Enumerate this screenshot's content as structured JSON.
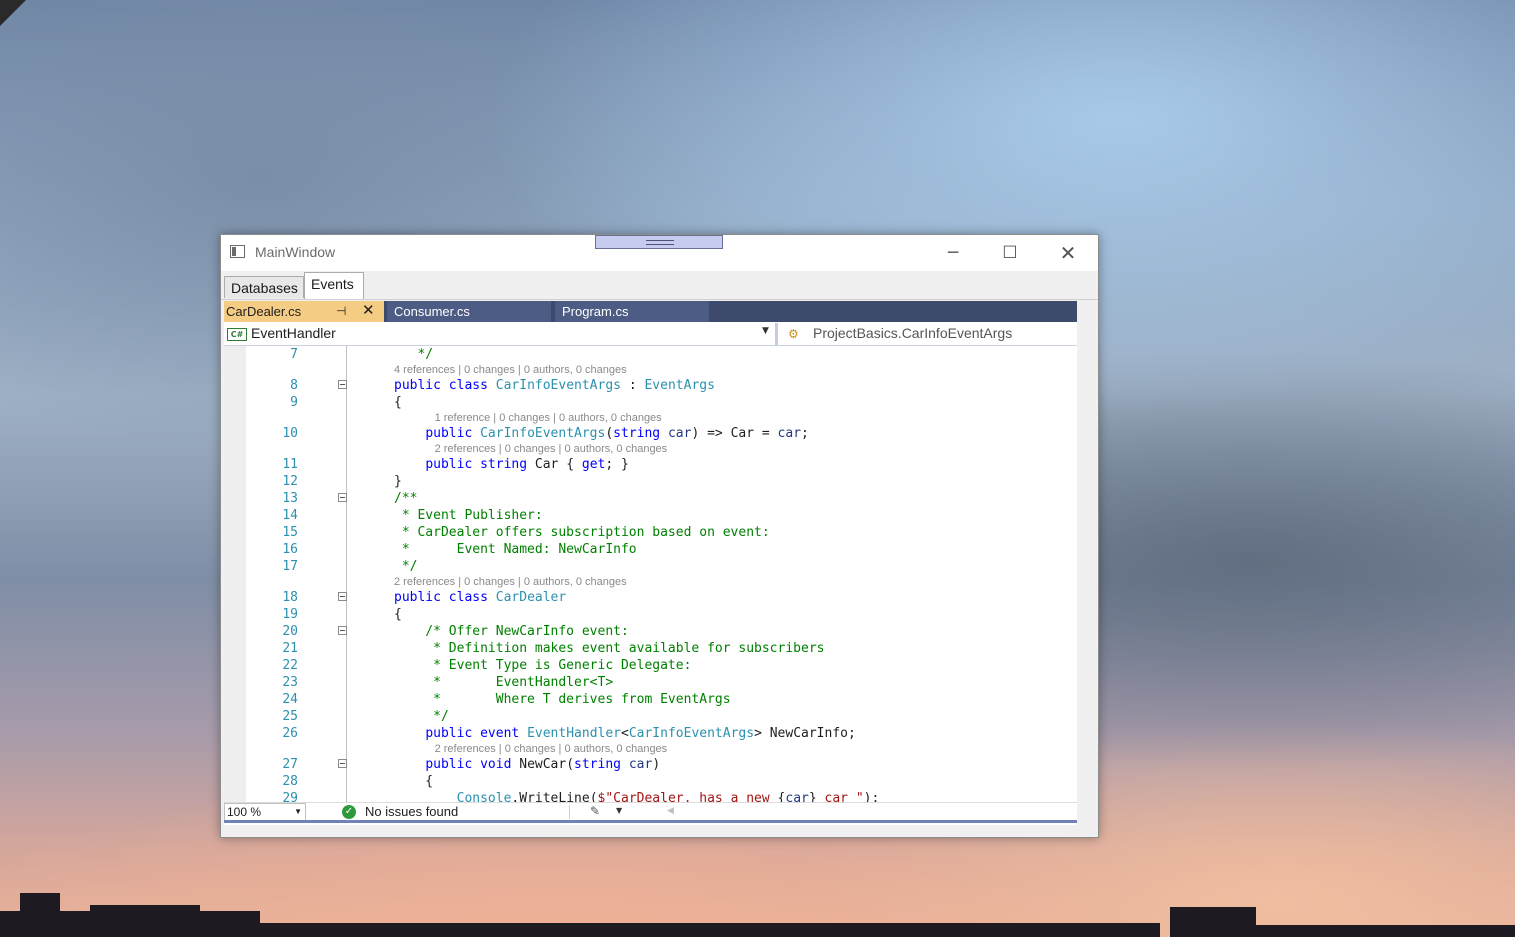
{
  "window": {
    "title": "MainWindow",
    "controls": {
      "minimize": "─",
      "maximize": "☐",
      "close": "✕"
    }
  },
  "window_tabs": [
    {
      "label": "Databases",
      "active": false
    },
    {
      "label": "Events",
      "active": true
    }
  ],
  "editor_tabs": [
    {
      "label": "CarDealer.cs",
      "active": true,
      "pin": "⊣",
      "close": "✕"
    },
    {
      "label": "Consumer.cs",
      "active": false
    },
    {
      "label": "Program.cs",
      "active": false
    }
  ],
  "navbar": {
    "language_badge": "C#",
    "left_member": "EventHandler",
    "right_member": "ProjectBasics.CarInfoEventArgs",
    "right_icon": "class-icon"
  },
  "code_lines": [
    {
      "n": "7",
      "code": "   */"
    },
    {
      "lens": "4 references | 0 changes | 0 authors, 0 changes"
    },
    {
      "n": "8",
      "code": "public class CarInfoEventArgs : EventArgs",
      "fold": true
    },
    {
      "n": "9",
      "code": "{"
    },
    {
      "lens": "1 reference | 0 changes | 0 authors, 0 changes"
    },
    {
      "n": "10",
      "code": "    public CarInfoEventArgs(string car) => Car = car;"
    },
    {
      "lens": "2 references | 0 changes | 0 authors, 0 changes"
    },
    {
      "n": "11",
      "code": "    public string Car { get; }"
    },
    {
      "n": "12",
      "code": "}"
    },
    {
      "n": "13",
      "code": "/**",
      "fold": true
    },
    {
      "n": "14",
      "code": " * Event Publisher:"
    },
    {
      "n": "15",
      "code": " * CarDealer offers subscription based on event:"
    },
    {
      "n": "16",
      "code": " *      Event Named: NewCarInfo"
    },
    {
      "n": "17",
      "code": " */"
    },
    {
      "lens": "2 references | 0 changes | 0 authors, 0 changes"
    },
    {
      "n": "18",
      "code": "public class CarDealer",
      "fold": true
    },
    {
      "n": "19",
      "code": "{"
    },
    {
      "n": "20",
      "code": "    /* Offer NewCarInfo event:",
      "fold": true
    },
    {
      "n": "21",
      "code": "     * Definition makes event available for subscribers"
    },
    {
      "n": "22",
      "code": "     * Event Type is Generic Delegate:"
    },
    {
      "n": "23",
      "code": "     *       EventHandler<T>"
    },
    {
      "n": "24",
      "code": "     *       Where T derives from EventArgs"
    },
    {
      "n": "25",
      "code": "     */"
    },
    {
      "n": "26",
      "code": "    public event EventHandler<CarInfoEventArgs> NewCarInfo;"
    },
    {
      "lens": "2 references | 0 changes | 0 authors, 0 changes"
    },
    {
      "n": "27",
      "code": "    public void NewCar(string car)",
      "fold": true
    },
    {
      "n": "28",
      "code": "    {"
    },
    {
      "n": "29",
      "code": "        Console.WriteLine($\"CarDealer, has a new {car} car \");"
    }
  ],
  "statusbar": {
    "zoom": "100 %",
    "issues": "No issues found"
  },
  "colors": {
    "keyword": "#0000ff",
    "type": "#2b91af",
    "comment": "#008000",
    "string": "#a31515",
    "active_tab": "#f5cc84",
    "tab_bar": "#3d4a6b"
  }
}
